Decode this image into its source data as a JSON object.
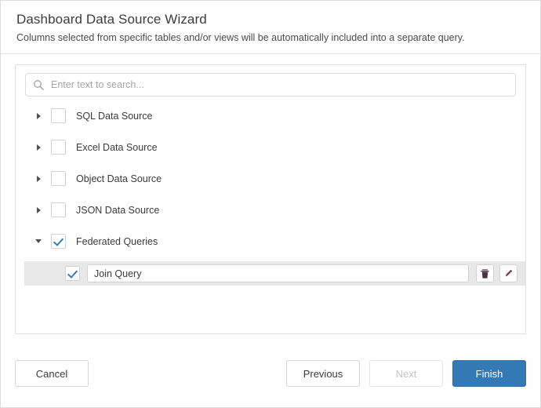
{
  "header": {
    "title": "Dashboard Data Source Wizard",
    "subtitle": "Columns selected from specific tables and/or views will be automatically included into a separate query."
  },
  "search": {
    "placeholder": "Enter text to search...",
    "value": "",
    "icon": "search-icon"
  },
  "tree": {
    "items": [
      {
        "label": "SQL Data Source",
        "expanded": false,
        "checked": false,
        "arrow": "chevron-right-icon"
      },
      {
        "label": "Excel Data Source",
        "expanded": false,
        "checked": false,
        "arrow": "chevron-right-icon"
      },
      {
        "label": "Object Data Source",
        "expanded": false,
        "checked": false,
        "arrow": "chevron-right-icon"
      },
      {
        "label": "JSON Data Source",
        "expanded": false,
        "checked": false,
        "arrow": "chevron-right-icon"
      },
      {
        "label": "Federated Queries",
        "expanded": true,
        "checked": true,
        "arrow": "chevron-down-icon"
      }
    ],
    "child": {
      "parent": "Federated Queries",
      "checked": true,
      "name_value": "Join Query",
      "delete_icon": "trash-icon",
      "edit_icon": "pencil-icon"
    }
  },
  "footer": {
    "cancel_label": "Cancel",
    "previous_label": "Previous",
    "next_label": "Next",
    "next_disabled": true,
    "finish_label": "Finish"
  },
  "colors": {
    "accent": "#3379b5",
    "check": "#2e7bc4",
    "row_highlight": "#e8e8e8",
    "border": "#e0e0e0",
    "text": "#3b3b3b",
    "placeholder": "#a6a6a6",
    "disabled_text": "#c3c3c3"
  }
}
